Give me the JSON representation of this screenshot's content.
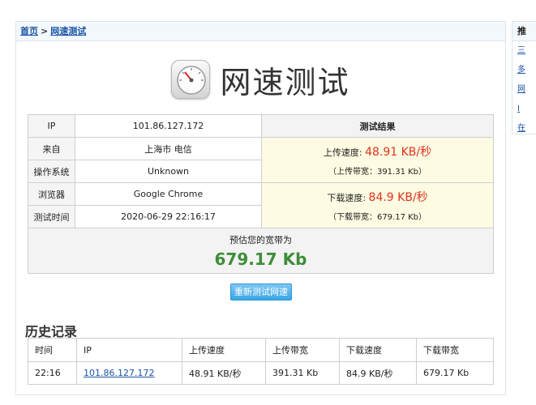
{
  "breadcrumb": {
    "home": "首页",
    "separator": ">",
    "current": "网速测试"
  },
  "title": "网速测试",
  "info": {
    "ip_label": "IP",
    "ip_value": "101.86.127.172",
    "from_label": "来自",
    "from_value": "上海市 电信",
    "os_label": "操作系统",
    "os_value": "Unknown",
    "browser_label": "浏览器",
    "browser_value": "Google Chrome",
    "time_label": "测试时间",
    "time_value": "2020-06-29 22:16:17"
  },
  "result": {
    "header": "测试结果",
    "upload_label": "上传速度:",
    "upload_value": "48.91 KB/秒",
    "upload_bw": "（上传带宽：391.31 Kb）",
    "download_label": "下载速度:",
    "download_value": "84.9 KB/秒",
    "download_bw": "（下载带宽：679.17 Kb）"
  },
  "estimate": {
    "label": "预估您的宽带为",
    "value": "679.17 Kb"
  },
  "retest_button": "重新测试网速",
  "history": {
    "title": "历史记录",
    "columns": [
      "时间",
      "IP",
      "上传速度",
      "上传带宽",
      "下载速度",
      "下载带宽"
    ],
    "rows": [
      [
        "22:16",
        "101.86.127.172",
        "48.91 KB/秒",
        "391.31 Kb",
        "84.9 KB/秒",
        "679.17 Kb"
      ]
    ]
  },
  "side": {
    "header": "推",
    "items": [
      "三",
      "多",
      "网",
      "I",
      "在"
    ]
  },
  "colors": {
    "link": "#1b55a6",
    "speed": "#e0311d",
    "estimate": "#3e8d37",
    "button": "#3aa6e6"
  }
}
